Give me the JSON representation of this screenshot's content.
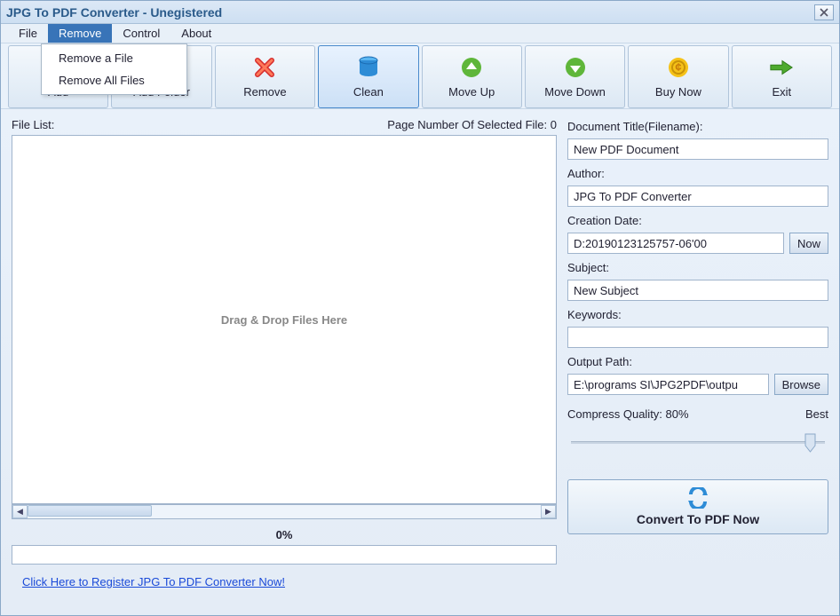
{
  "window": {
    "title": "JPG To PDF Converter - Unegistered"
  },
  "menu": {
    "items": [
      "File",
      "Remove",
      "Control",
      "About"
    ],
    "active_index": 1,
    "dropdown": [
      "Remove a File",
      "Remove All Files"
    ]
  },
  "toolbar": [
    {
      "label": "Add",
      "icon": "plus"
    },
    {
      "label": "Add Folder",
      "icon": "folder"
    },
    {
      "label": "Remove",
      "icon": "x-red"
    },
    {
      "label": "Clean",
      "icon": "cylinder",
      "selected": true
    },
    {
      "label": "Move Up",
      "icon": "up-green"
    },
    {
      "label": "Move Down",
      "icon": "down-green"
    },
    {
      "label": "Buy Now",
      "icon": "coin"
    },
    {
      "label": "Exit",
      "icon": "arrow-right"
    }
  ],
  "filelist": {
    "label": "File List:",
    "page_label": "Page Number Of Selected File: 0",
    "dropzone": "Drag & Drop Files Here"
  },
  "progress": {
    "label": "0%"
  },
  "register_link": "Click Here to Register JPG To PDF Converter Now!",
  "form": {
    "title_label": "Document Title(Filename):",
    "title_value": "New PDF Document",
    "author_label": "Author:",
    "author_value": "JPG To PDF Converter",
    "date_label": "Creation Date:",
    "date_value": "D:20190123125757-06'00",
    "now_btn": "Now",
    "subject_label": "Subject:",
    "subject_value": "New Subject",
    "keywords_label": "Keywords:",
    "keywords_value": "",
    "output_label": "Output Path:",
    "output_value": "E:\\programs SI\\JPG2PDF\\outpu",
    "browse_btn": "Browse",
    "quality_label": "Compress Quality: 80%",
    "quality_best": "Best"
  },
  "convert": {
    "label": "Convert To PDF Now"
  }
}
